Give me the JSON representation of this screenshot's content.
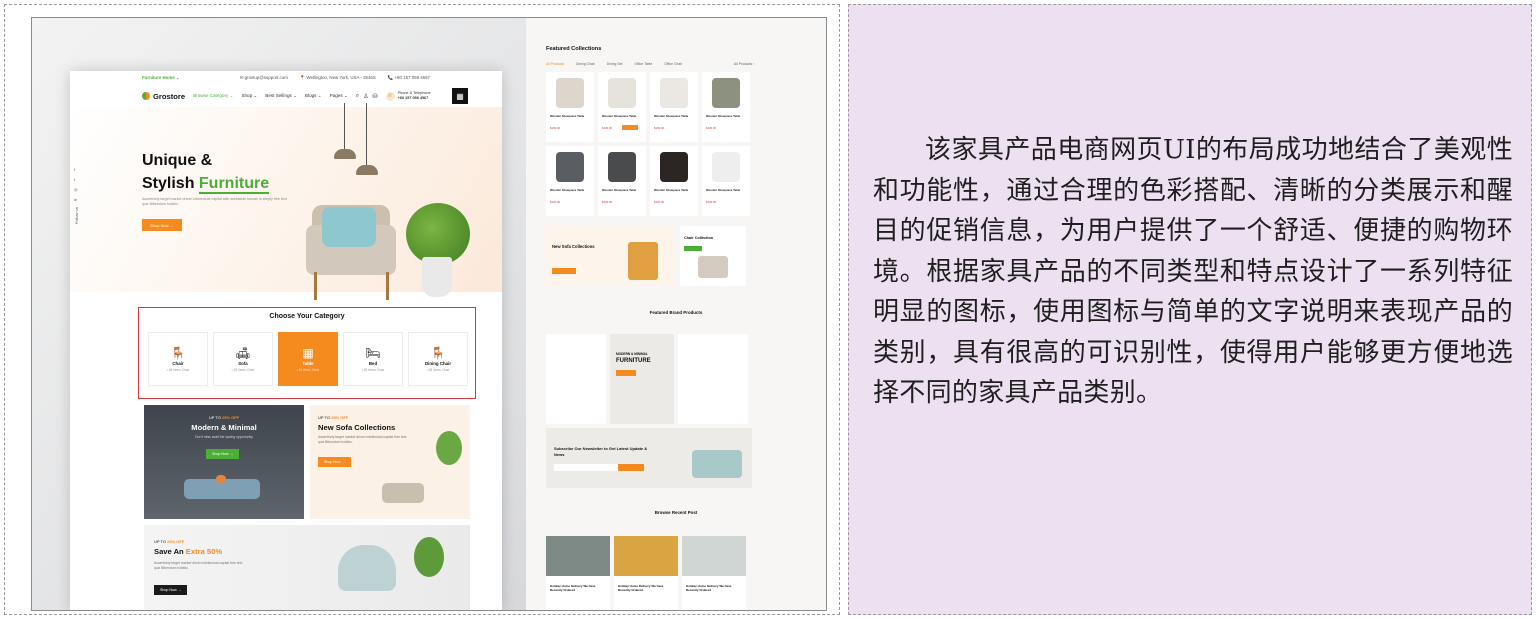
{
  "front": {
    "topbar": {
      "home_link": "Furniture Home ⌄",
      "email": "✉ grostup@support.com",
      "address": "📍 Wellington, New York, USA - 2546S",
      "phone": "📞 +80 157 058 4567"
    },
    "nav": {
      "brand": "Grostore",
      "items": [
        "Browse Category ⌄",
        "Shop ⌄",
        "Best Sellings ⌄",
        "Blogs ⌄",
        "Pages ⌄"
      ],
      "phone_label": "Phone & Telephone",
      "phone_number": "+80 157 058 4567"
    },
    "hero": {
      "line1": "Unique &",
      "line2_plain": "Stylish ",
      "line2_accent": "Furniture",
      "body": "Assertively target market driven intellectual capital with worldwide human is simply free text quiz Bibendum holistic.",
      "cta": "Shop Now →",
      "social": [
        "f",
        "t",
        "◎",
        "in",
        "Follow on"
      ]
    },
    "categories": {
      "title": "Choose Your Category",
      "items": [
        {
          "icon": "🪑",
          "name": "Chair",
          "count": "• 28 Items Chair"
        },
        {
          "icon": "🛋",
          "name": "Sofa",
          "count": "• 28 Items Chair"
        },
        {
          "icon": "▦",
          "name": "Table",
          "count": "• 28 Items Table"
        },
        {
          "icon": "🛏",
          "name": "Bed",
          "count": "• 28 Items Chair"
        },
        {
          "icon": "🪑",
          "name": "Dining Chair",
          "count": "• 28 Items Chair"
        }
      ]
    },
    "banners": {
      "modern": {
        "kicker": "UP TO ",
        "pct": "25% OFF",
        "title": "Modern & Minimal",
        "sub": "Don't miss avail the saving opportunity",
        "cta": "Shop Now →"
      },
      "sofa": {
        "kicker": "UP TO ",
        "pct": "25% OFF",
        "title": "New Sofa Collections",
        "sub": "Assertively target market driven intellectual capital free text quiz Bibendum holistic.",
        "cta": "Shop Now →"
      },
      "save": {
        "kicker": "UP TO ",
        "pct": "25% OFF",
        "title_plain": "Save An ",
        "title_accent": "Extra 50%",
        "sub": "Assertively target market driven intellectual capital free text quiz Bibendum holistic.",
        "cta": "Shop Now →"
      }
    }
  },
  "back": {
    "featured_title": "Featured Collections",
    "tabs": [
      "All Products",
      "Dining Chair",
      "Dining Set",
      "Office Table",
      "Office Chair"
    ],
    "all_products": "All Products ›",
    "product_name": "Wooden Showpiece Table",
    "product_price": "$100.00",
    "sofa_promo": "New Sofa Collections",
    "chair_promo": "Chair Collection",
    "brand_title": "Featured Brand Products",
    "brand_banner_kicker": "MODERN & MINIMAL",
    "brand_banner_title": "FURNITURE",
    "newsletter": "Subscribe Our Newsletter to Get Latest Update & News",
    "recent_title": "Browse Recent Post",
    "post_title": "Holiday Home Delivery We have Recently Ordered"
  },
  "description": "该家具产品电商网页UI的布局成功地结合了美观性和功能性，通过合理的色彩搭配、清晰的分类展示和醒目的促销信息，为用户提供了一个舒适、便捷的购物环境。根据家具产品的不同类型和特点设计了一系列特征明显的图标，使用图标与简单的文字说明来表现产品的类别，具有很高的可识别性，使得用户能够更方便地选择不同的家具产品类别。",
  "colors": {
    "accent_orange": "#f58a1f",
    "accent_green": "#4caf35",
    "highlight_red": "#d9343c",
    "panel_bg": "#ede1f1"
  }
}
